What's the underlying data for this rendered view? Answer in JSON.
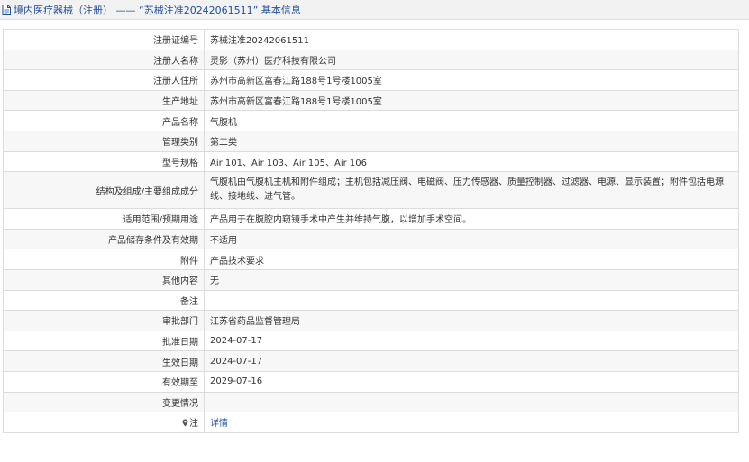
{
  "header": {
    "breadcrumb": "境内医疗器械（注册） —— “苏械注准20242061511” 基本信息"
  },
  "rows": [
    {
      "label": "注册证编号",
      "value": "苏械注准20242061511"
    },
    {
      "label": "注册人名称",
      "value": "灵影（苏州）医疗科技有限公司"
    },
    {
      "label": "注册人住所",
      "value": "苏州市高新区富春江路188号1号楼1005室"
    },
    {
      "label": "生产地址",
      "value": "苏州市高新区富春江路188号1号楼1005室"
    },
    {
      "label": "产品名称",
      "value": "气腹机"
    },
    {
      "label": "管理类别",
      "value": "第二类"
    },
    {
      "label": "型号规格",
      "value": "Air 101、Air 103、Air 105、Air 106"
    },
    {
      "label": "结构及组成/主要组成成分",
      "value": "气腹机由气腹机主机和附件组成；主机包括减压阀、电磁阀、压力传感器、质量控制器、过滤器、电源、显示装置；附件包括电源线、接地线、进气管。"
    },
    {
      "label": "适用范围/预期用途",
      "value": "产品用于在腹腔内窥镜手术中产生并维持气腹，以增加手术空间。"
    },
    {
      "label": "产品储存条件及有效期",
      "value": "不适用"
    },
    {
      "label": "附件",
      "value": "产品技术要求"
    },
    {
      "label": "其他内容",
      "value": "无"
    },
    {
      "label": "备注",
      "value": ""
    },
    {
      "label": "审批部门",
      "value": "江苏省药品监督管理局"
    },
    {
      "label": "批准日期",
      "value": "2024-07-17"
    },
    {
      "label": "生效日期",
      "value": "2024-07-17"
    },
    {
      "label": "有效期至",
      "value": "2029-07-16"
    },
    {
      "label": "变更情况",
      "value": ""
    },
    {
      "label": "注",
      "value": "详情"
    }
  ],
  "colors": {
    "link": "#1f4f9c",
    "border": "#dcdcdc",
    "header_bg": "#f2f2f2",
    "stripe": "#f7f7f7"
  }
}
